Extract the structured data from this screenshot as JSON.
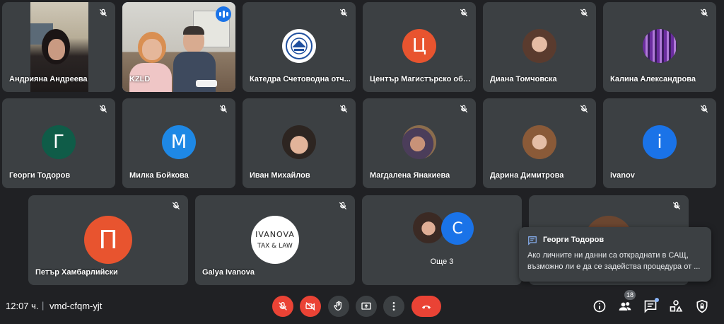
{
  "participants": {
    "p1": {
      "name": "Андрияна Андреева"
    },
    "p2": {
      "name": "KZLD"
    },
    "p3": {
      "name": "Катедра Счетоводна отч..."
    },
    "p4": {
      "name": "Център Магистърско обу...",
      "initial": "Ц",
      "color": "#e8542f"
    },
    "p5": {
      "name": "Диана Томчовска"
    },
    "p6": {
      "name": "Калина Александрова"
    },
    "p7": {
      "name": "Георги Тодоров",
      "initial": "Г",
      "color": "#0f5c48"
    },
    "p8": {
      "name": "Милка Бойкова",
      "initial": "М",
      "color": "#1e88e5"
    },
    "p9": {
      "name": "Иван Михайлов"
    },
    "p10": {
      "name": "Магдалена Янакиева"
    },
    "p11": {
      "name": "Дарина Димитрова"
    },
    "p12": {
      "name": "ivanov",
      "initial": "i",
      "color": "#1a73e8"
    },
    "p13": {
      "name": "Петър Хамбарлийски",
      "initial": "П",
      "color": "#e8542f"
    },
    "p14": {
      "name": "Galya Ivanova",
      "logo_top": "IVANOVA",
      "logo_bottom": "TAX & LAW"
    },
    "more": {
      "initial": "С",
      "color": "#1a73e8",
      "label": "Още 3"
    }
  },
  "chat_notification": {
    "sender": "Георги Тодоров",
    "message": "Ако личните ни данни са откраднати в САЩ, възможно ли е да се задейства процедура от ..."
  },
  "meeting": {
    "time": "12:07 ч.",
    "separator": "|",
    "code": "vmd-cfqm-yjt"
  },
  "controls": {
    "participant_count": "18",
    "accent_red": "#ea4335",
    "button_gray": "#3c4043"
  }
}
